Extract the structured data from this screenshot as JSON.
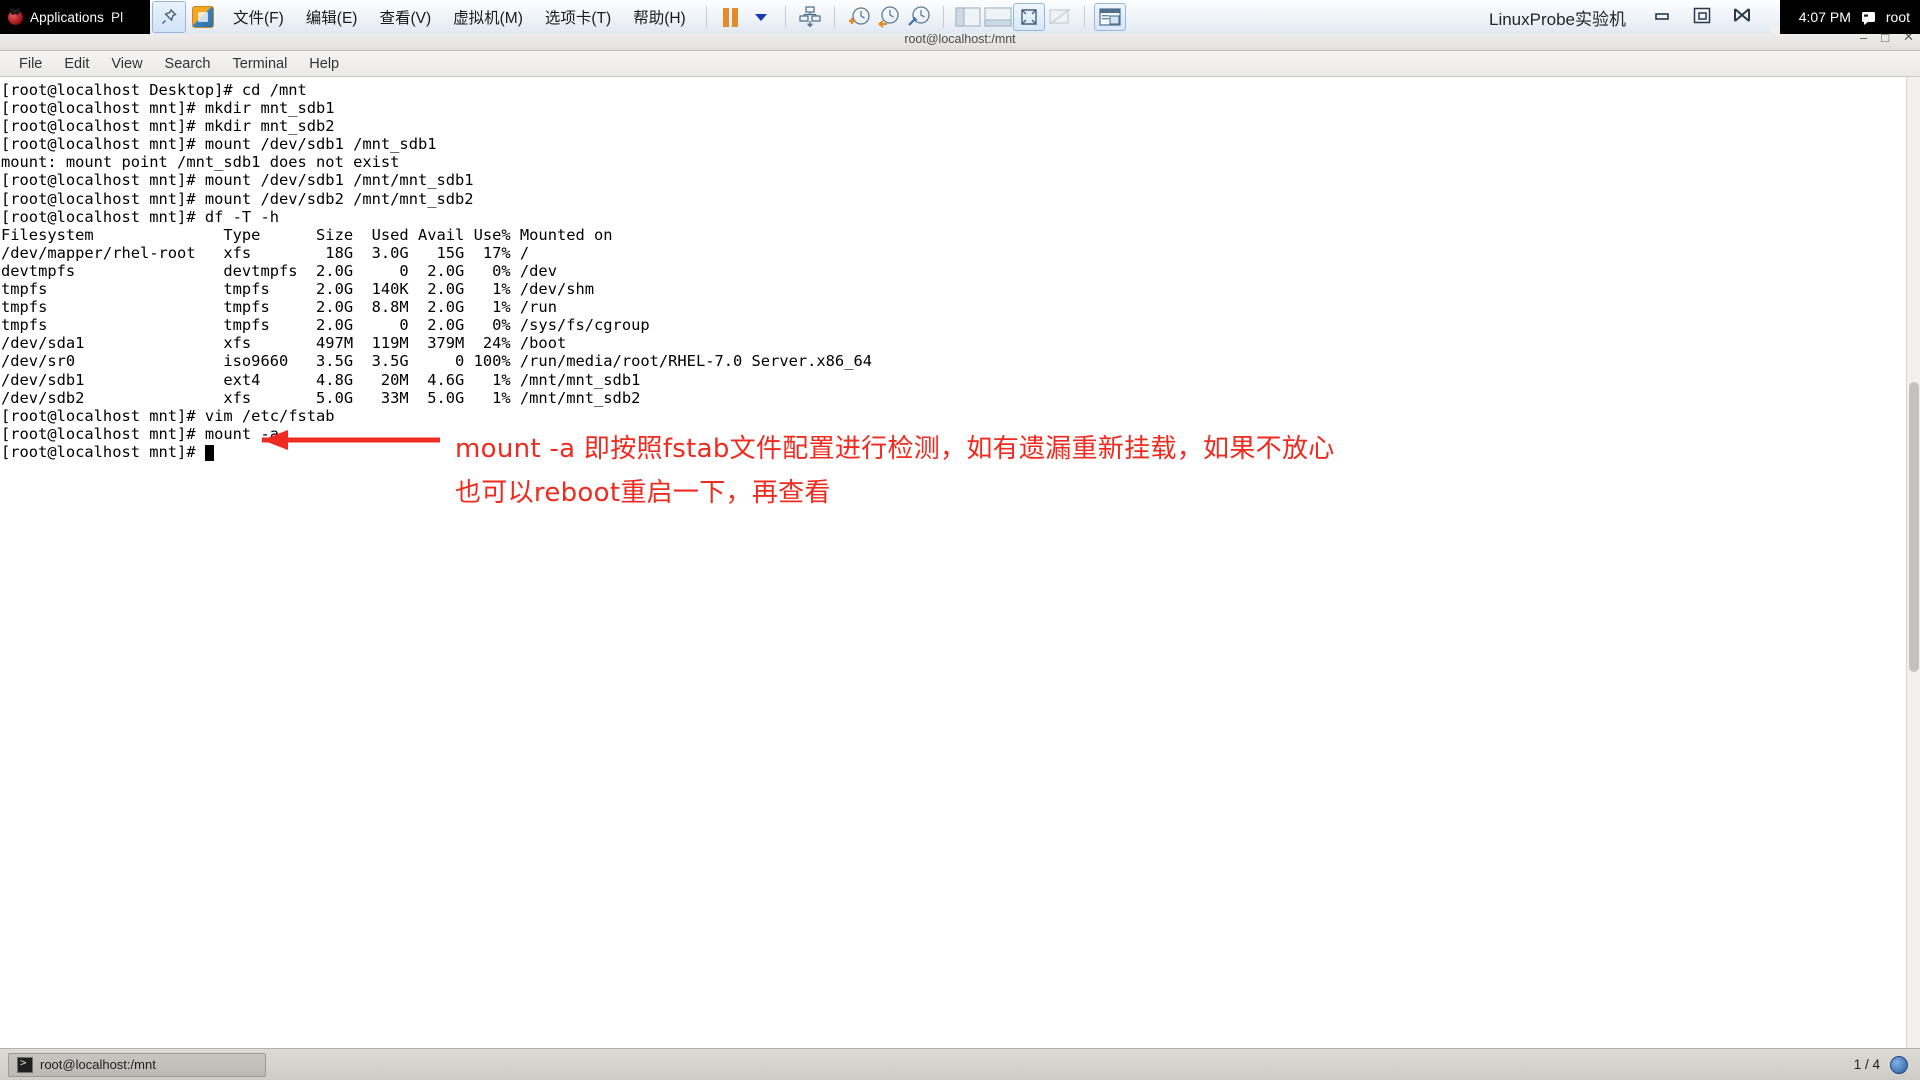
{
  "gnome_panel": {
    "activities_label": "Applications",
    "places_label": "Pl",
    "clock": "4:07 PM",
    "user": "root",
    "logo_icon": "gnome-foot-icon",
    "user_icon": "user-status-icon"
  },
  "vmware": {
    "pin_icon": "pin-icon",
    "app_icon": "vmware-app-icon",
    "menus": [
      {
        "name": "file",
        "label": "文件(F)",
        "mnemonic": "F"
      },
      {
        "name": "edit",
        "label": "编辑(E)",
        "mnemonic": "E"
      },
      {
        "name": "view",
        "label": "查看(V)",
        "mnemonic": "V"
      },
      {
        "name": "vm",
        "label": "虚拟机(M)",
        "mnemonic": "M"
      },
      {
        "name": "tabs",
        "label": "选项卡(T)",
        "mnemonic": "T"
      },
      {
        "name": "help",
        "label": "帮助(H)",
        "mnemonic": "H"
      }
    ],
    "toolbar_icons": [
      "pause-icon",
      "dropdown-caret-icon",
      "send-ctrl-alt-del-icon",
      "snapshot-take-icon",
      "snapshot-revert-icon",
      "snapshot-manager-icon",
      "show-sidebar-icon",
      "show-thumbnail-bar-icon",
      "fullscreen-icon",
      "unity-mode-icon",
      "console-view-icon"
    ],
    "title": "LinuxProbe实验机",
    "window_buttons": [
      "minimize",
      "restore",
      "close"
    ]
  },
  "terminal": {
    "title": "root@localhost:/mnt",
    "window_buttons": [
      "minimize",
      "maximize",
      "close"
    ],
    "menubar": [
      "File",
      "Edit",
      "View",
      "Search",
      "Terminal",
      "Help"
    ],
    "lines": [
      "[root@localhost Desktop]# cd /mnt",
      "[root@localhost mnt]# mkdir mnt_sdb1",
      "[root@localhost mnt]# mkdir mnt_sdb2",
      "[root@localhost mnt]# mount /dev/sdb1 /mnt_sdb1",
      "mount: mount point /mnt_sdb1 does not exist",
      "[root@localhost mnt]# mount /dev/sdb1 /mnt/mnt_sdb1",
      "[root@localhost mnt]# mount /dev/sdb2 /mnt/mnt_sdb2",
      "[root@localhost mnt]# df -T -h",
      "Filesystem              Type      Size  Used Avail Use% Mounted on",
      "/dev/mapper/rhel-root   xfs        18G  3.0G   15G  17% /",
      "devtmpfs                devtmpfs  2.0G     0  2.0G   0% /dev",
      "tmpfs                   tmpfs     2.0G  140K  2.0G   1% /dev/shm",
      "tmpfs                   tmpfs     2.0G  8.8M  2.0G   1% /run",
      "tmpfs                   tmpfs     2.0G     0  2.0G   0% /sys/fs/cgroup",
      "/dev/sda1               xfs       497M  119M  379M  24% /boot",
      "/dev/sr0                iso9660   3.5G  3.5G     0 100% /run/media/root/RHEL-7.0 Server.x86_64",
      "/dev/sdb1               ext4      4.8G   20M  4.6G   1% /mnt/mnt_sdb1",
      "/dev/sdb2               xfs       5.0G   33M  5.0G   1% /mnt/mnt_sdb2",
      "[root@localhost mnt]# vim /etc/fstab",
      "[root@localhost mnt]# mount -a",
      "[root@localhost mnt]# "
    ]
  },
  "annotation": {
    "color": "#ef2a1e",
    "arrow_icon": "left-arrow-icon",
    "line1": "mount -a 即按照fstab文件配置进行检测，如有遗漏重新挂载，如果不放心",
    "line2": "也可以reboot重启一下，再查看"
  },
  "taskbar": {
    "item_label": "root@localhost:/mnt",
    "item_icon": "terminal-icon",
    "workspace": "1 / 4",
    "workspace_icon": "workspace-switcher-icon"
  }
}
